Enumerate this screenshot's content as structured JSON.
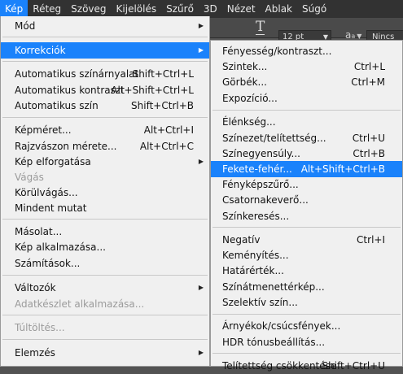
{
  "menubar": {
    "items": [
      "Kép",
      "Réteg",
      "Szöveg",
      "Kijelölés",
      "Szűrő",
      "3D",
      "Nézet",
      "Ablak",
      "Súgó"
    ],
    "active_index": 0
  },
  "options_bar": {
    "text_tool_icon": "text-orientation-icon",
    "font_size": "12 pt",
    "aa_label": "a",
    "aa_sub": "a",
    "antialias": "Nincs"
  },
  "image_menu": [
    {
      "label": "Mód",
      "shortcut": "",
      "submenu": true
    },
    {
      "label": "Korrekciók",
      "shortcut": "",
      "submenu": true,
      "highlighted": true
    },
    {
      "label": "Automatikus színárnyalat",
      "shortcut": "Shift+Ctrl+L"
    },
    {
      "label": "Automatikus kontraszt",
      "shortcut": "Alt+Shift+Ctrl+L"
    },
    {
      "label": "Automatikus szín",
      "shortcut": "Shift+Ctrl+B"
    },
    {
      "label": "Képméret...",
      "shortcut": "Alt+Ctrl+I"
    },
    {
      "label": "Rajzvászon mérete...",
      "shortcut": "Alt+Ctrl+C"
    },
    {
      "label": "Kép elforgatása",
      "shortcut": "",
      "submenu": true
    },
    {
      "label": "Vágás",
      "shortcut": "",
      "disabled": true
    },
    {
      "label": "Körülvágás...",
      "shortcut": ""
    },
    {
      "label": "Mindent mutat",
      "shortcut": ""
    },
    {
      "label": "Másolat...",
      "shortcut": ""
    },
    {
      "label": "Kép alkalmazása...",
      "shortcut": ""
    },
    {
      "label": "Számítások...",
      "shortcut": ""
    },
    {
      "label": "Változók",
      "shortcut": "",
      "submenu": true
    },
    {
      "label": "Adatkészlet alkalmazása...",
      "shortcut": "",
      "disabled": true
    },
    {
      "label": "Túltöltés...",
      "shortcut": "",
      "disabled": true
    },
    {
      "label": "Elemzés",
      "shortcut": "",
      "submenu": true
    }
  ],
  "adjustments_menu": [
    {
      "label": "Fényesség/kontraszt...",
      "shortcut": ""
    },
    {
      "label": "Szintek...",
      "shortcut": "Ctrl+L"
    },
    {
      "label": "Görbék...",
      "shortcut": "Ctrl+M"
    },
    {
      "label": "Expozíció...",
      "shortcut": ""
    },
    {
      "label": "Élénkség...",
      "shortcut": ""
    },
    {
      "label": "Színezet/telítettség...",
      "shortcut": "Ctrl+U"
    },
    {
      "label": "Színegyensúly...",
      "shortcut": "Ctrl+B"
    },
    {
      "label": "Fekete-fehér...",
      "shortcut": "Alt+Shift+Ctrl+B",
      "highlighted": true
    },
    {
      "label": "Fényképszűrő...",
      "shortcut": ""
    },
    {
      "label": "Csatornakeverő...",
      "shortcut": ""
    },
    {
      "label": "Színkeresés...",
      "shortcut": ""
    },
    {
      "label": "Negatív",
      "shortcut": "Ctrl+I"
    },
    {
      "label": "Keményítés...",
      "shortcut": ""
    },
    {
      "label": "Határérték...",
      "shortcut": ""
    },
    {
      "label": "Színátmenettérkép...",
      "shortcut": ""
    },
    {
      "label": "Szelektív szín...",
      "shortcut": ""
    },
    {
      "label": "Árnyékok/csúcsfények...",
      "shortcut": ""
    },
    {
      "label": "HDR tónusbeállítás...",
      "shortcut": ""
    },
    {
      "label": "Telítettség csökkentése",
      "shortcut": "Shift+Ctrl+U"
    }
  ]
}
